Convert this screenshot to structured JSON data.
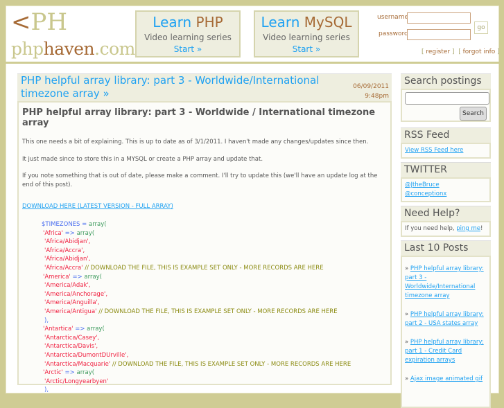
{
  "header": {
    "logo_mark": "PH",
    "logo_domain_a": "php",
    "logo_domain_b": "haven",
    "logo_domain_c": ".com",
    "promos": [
      {
        "learn": "Learn ",
        "subject": "PHP",
        "subtitle": "Video learning series",
        "cta": "Start »"
      },
      {
        "learn": "Learn ",
        "subject": "MySQL",
        "subtitle": "Video learning series",
        "cta": "Start »"
      }
    ],
    "login": {
      "username_label": "username",
      "password_label": "password",
      "go": "go",
      "register": "register",
      "forgot": "forgot info"
    }
  },
  "post": {
    "title": "PHP helpful array library: part 3 - Worldwide/International timezone array »",
    "date": "06/09/2011",
    "time": "9:48pm",
    "heading": "PHP helpful array library: part 3 - Worldwide / International timezone array",
    "paragraphs": [
      "This one needs a bit of explaining.  This is up to date as of 3/1/2011. I haven't made any changes/updates since then.",
      "It just made since to store this in a MYSQL or create a PHP array and update that.",
      "If you note something that is out of date, please make a comment. I'll try to update this (we'll have an update log at the end of this post)."
    ],
    "download": "DOWNLOAD HERE (LATEST VERSION - FULL ARRAY)",
    "code": {
      "var": "$TIMEZONES",
      "eq": " = ",
      "arr": "array(",
      "arrow": " => ",
      "comment": " // DOWNLOAD THE FILE, THIS IS EXAMPLE SET ONLY - MORE RECORDS ARE HERE",
      "close": "),",
      "africa": "'Africa'",
      "africa_items": [
        "'Africa/Abidjan',",
        "'Africa/Accra',",
        "'Africa/Abidjan',",
        "'Africa/Accra'"
      ],
      "america": "'America'",
      "america_items": [
        "'America/Adak',",
        "'America/Anchorage',",
        "'America/Anguilla',",
        "'America/Antigua'"
      ],
      "antartica": "'Antartica'",
      "antartica_items": [
        "'Antarctica/Casey',",
        "'Antarctica/Davis',",
        "'Antarctica/DumontDUrville',",
        "'Antarctica/Macquarie'"
      ],
      "arctic": "'Arctic'",
      "arctic_items": [
        "'Arctic/Longyearbyen'"
      ]
    }
  },
  "sidebar": {
    "search_title": "Search postings",
    "search_button": "Search",
    "rss_title": "RSS Feed",
    "rss_link": "View RSS Feed here",
    "twitter_title": "TWITTER",
    "twitter": [
      "@JtheBruce",
      "@conceptionx"
    ],
    "help_title": "Need Help?",
    "help_text": "If you need help, ",
    "help_link": "ping me",
    "help_end": "!",
    "last_title": "Last 10 Posts",
    "posts": [
      "PHP helpful array library: part 3 - Worldwide/International timezone array",
      "PHP helpful array library: part 2 - USA states array",
      "PHP helpful array library: part 1 - Credit Card expiration arrays",
      "Ajax image animated gif"
    ]
  }
}
